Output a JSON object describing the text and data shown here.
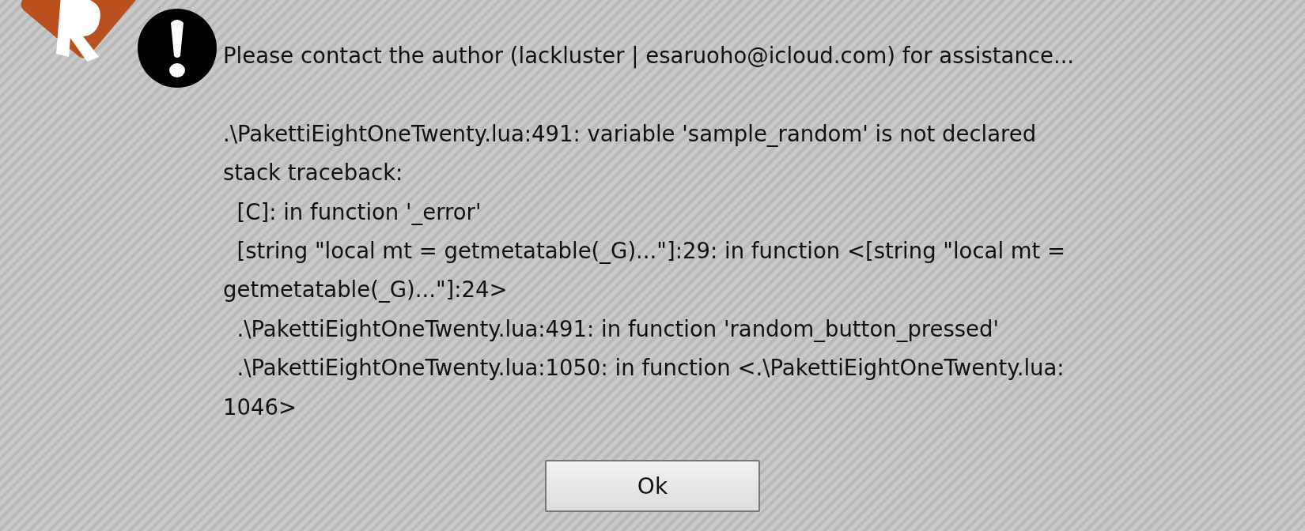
{
  "dialog": {
    "summary": "Please contact the author (lackluster | esaruoho@icloud.com) for assistance...",
    "traceback_lines": [
      ".\\PakettiEightOneTwenty.lua:491: variable 'sample_random' is not declared",
      "stack traceback:",
      "  [C]: in function '_error'",
      "  [string \"local mt = getmetatable(_G)...\"]:29: in function <[string \"local mt =",
      "getmetatable(_G)...\"]:24>",
      "  .\\PakettiEightOneTwenty.lua:491: in function 'random_button_pressed'",
      "  .\\PakettiEightOneTwenty.lua:1050: in function <.\\PakettiEightOneTwenty.lua:",
      "1046>"
    ],
    "buttons": [
      "Ok"
    ]
  }
}
